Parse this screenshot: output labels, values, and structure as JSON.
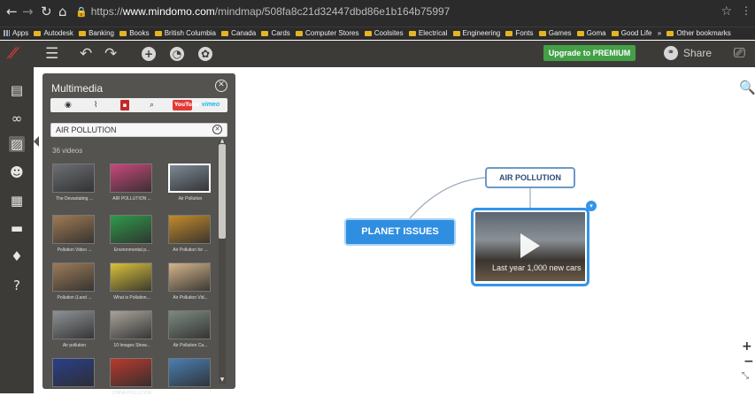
{
  "browser": {
    "url_scheme": "https://",
    "url_host": "www.mindomo.com",
    "url_path": "/mindmap/508fa8c21d32447dbd86e1b164b75997",
    "bookmarks": [
      "Apps",
      "Autodesk",
      "Banking",
      "Books",
      "British Columbia",
      "Canada",
      "Cards",
      "Computer Stores",
      "Coolsites",
      "Electrical",
      "Engineering",
      "Fonts",
      "Games",
      "Goma",
      "Good Life",
      "»",
      "Other bookmarks"
    ]
  },
  "toolbar": {
    "upgrade_label": "Upgrade to PREMIUM",
    "share_label": "Share"
  },
  "panel": {
    "title": "Multimedia",
    "search_value": "AIR POLLUTION",
    "count": "36 videos",
    "sources": [
      "photo",
      "attach",
      "flag",
      "search",
      "youtube",
      "vimeo"
    ],
    "youtube_label": "YouTube",
    "vimeo_label": "vimeo",
    "videos": [
      {
        "label": "The Devastating ...",
        "color": "#6b6e73"
      },
      {
        "label": "AIR POLLUTION ...",
        "color": "#c9487a"
      },
      {
        "label": "Air Pollution",
        "color": "#7c8894"
      },
      {
        "label": "Pollution Video ...",
        "color": "#a07a54"
      },
      {
        "label": "Environmental p...",
        "color": "#2f9a4a"
      },
      {
        "label": "Air Pollution for ...",
        "color": "#c48a2c"
      },
      {
        "label": "Pollution (Land ...",
        "color": "#9c7b58"
      },
      {
        "label": "What is Pollution...",
        "color": "#d9c23a"
      },
      {
        "label": "Air Pollution Vid...",
        "color": "#d4b48a"
      },
      {
        "label": "Air pollution",
        "color": "#8e9296"
      },
      {
        "label": "10 Images Show...",
        "color": "#a8a39a"
      },
      {
        "label": "Air Pollution Ca...",
        "color": "#7d8a80"
      },
      {
        "label": "",
        "color": "#2a3f8a"
      },
      {
        "label": "CHINA POLLUTION",
        "color": "#b83a2e"
      },
      {
        "label": "",
        "color": "#4a7fb4"
      }
    ]
  },
  "map": {
    "central_topic": "PLANET ISSUES",
    "subtopic": "AIR POLLUTION",
    "video_caption": "Last year 1,000 new cars",
    "accent": "#2f8ee0"
  },
  "icons": {
    "left_bar": [
      "outline-icon",
      "link-icon",
      "multimedia-icon",
      "smiley-icon",
      "notes-icon",
      "comments-icon",
      "idea-icon",
      "help-icon"
    ]
  }
}
